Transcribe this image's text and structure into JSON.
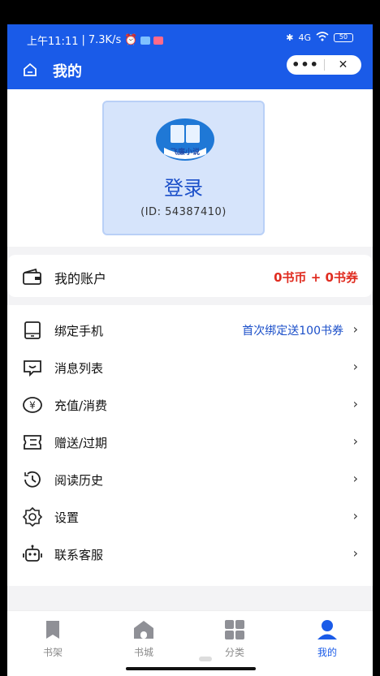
{
  "status_bar": {
    "time": "上午11:11",
    "network_speed": "7.3K/s",
    "battery": "50",
    "signal": "4G"
  },
  "header": {
    "title": "我的",
    "home_icon": "home-icon",
    "capsule_more": "•••",
    "capsule_close": "✕"
  },
  "profile": {
    "logo_text": "飞廉小说",
    "login_label": "登录",
    "user_id": "(ID: 54387410)"
  },
  "account": {
    "label": "我的账户",
    "value": "0书币 + 0书券",
    "value_color": "#e02c20"
  },
  "menu": {
    "items": [
      {
        "label": "绑定手机",
        "hint": "首次绑定送100书券",
        "icon": "phone-icon"
      },
      {
        "label": "消息列表",
        "hint": "",
        "icon": "message-icon"
      },
      {
        "label": "充值/消费",
        "hint": "",
        "icon": "yen-icon"
      },
      {
        "label": "赠送/过期",
        "hint": "",
        "icon": "ticket-icon"
      },
      {
        "label": "阅读历史",
        "hint": "",
        "icon": "history-icon"
      },
      {
        "label": "设置",
        "hint": "",
        "icon": "gear-icon"
      },
      {
        "label": "联系客服",
        "hint": "",
        "icon": "robot-icon"
      }
    ],
    "chevron": "›"
  },
  "nav": {
    "tabs": [
      {
        "label": "书架",
        "active": false,
        "icon": "bookmark-icon"
      },
      {
        "label": "书城",
        "active": false,
        "icon": "store-icon"
      },
      {
        "label": "分类",
        "active": false,
        "icon": "grid-icon"
      },
      {
        "label": "我的",
        "active": true,
        "icon": "user-icon"
      }
    ]
  },
  "colors": {
    "brand": "#1a5be8",
    "accent_text": "#1b4fc9",
    "inactive": "#8a8a8a"
  }
}
